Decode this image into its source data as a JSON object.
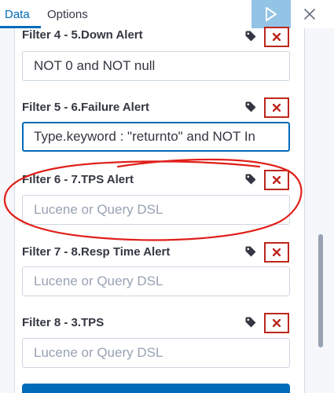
{
  "tabs": [
    {
      "label": "Data",
      "active": true
    },
    {
      "label": "Options",
      "active": false
    }
  ],
  "toolbar": {
    "apply_icon": "play-icon",
    "close_icon": "close-icon"
  },
  "filters": [
    {
      "label": "Filter 4 - 5.Down Alert",
      "value": "NOT 0 and NOT null",
      "placeholder": "Lucene or Query DSL"
    },
    {
      "label": "Filter 5 - 6.Failure Alert",
      "value": "Type.keyword : \"returnto\" and NOT In",
      "placeholder": "Lucene or Query DSL"
    },
    {
      "label": "Filter 6 - 7.TPS Alert",
      "value": "",
      "placeholder": "Lucene or Query DSL"
    },
    {
      "label": "Filter 7 - 8.Resp Time Alert",
      "value": "",
      "placeholder": "Lucene or Query DSL"
    },
    {
      "label": "Filter 8 - 3.TPS",
      "value": "",
      "placeholder": "Lucene or Query DSL"
    }
  ],
  "colors": {
    "accent": "#006bb8",
    "danger": "#bd271e",
    "annotation": "#e0201a"
  }
}
